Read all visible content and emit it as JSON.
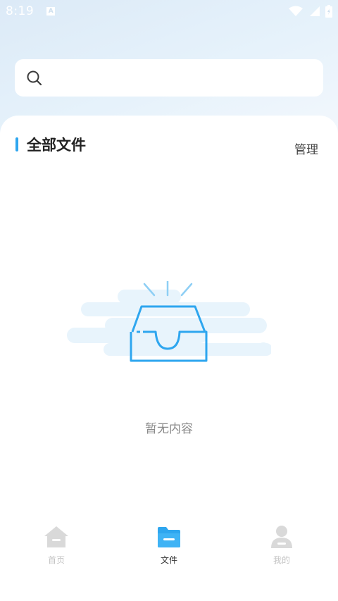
{
  "status_bar": {
    "time": "8:19",
    "notification_glyph": "A",
    "icons": [
      "wifi-icon",
      "signal-icon",
      "battery-charging-icon"
    ]
  },
  "search": {
    "icon": "search-icon",
    "placeholder": ""
  },
  "section": {
    "title": "全部文件",
    "manage_label": "管理"
  },
  "empty_state": {
    "icon": "empty-inbox-icon",
    "message": "暂无内容"
  },
  "tabs": [
    {
      "label": "首页",
      "icon": "home-icon",
      "active": false
    },
    {
      "label": "文件",
      "icon": "folder-icon",
      "active": true
    },
    {
      "label": "我的",
      "icon": "user-icon",
      "active": false
    }
  ],
  "colors": {
    "accent": "#2ea6ef",
    "inactive": "#d6d6d6"
  }
}
